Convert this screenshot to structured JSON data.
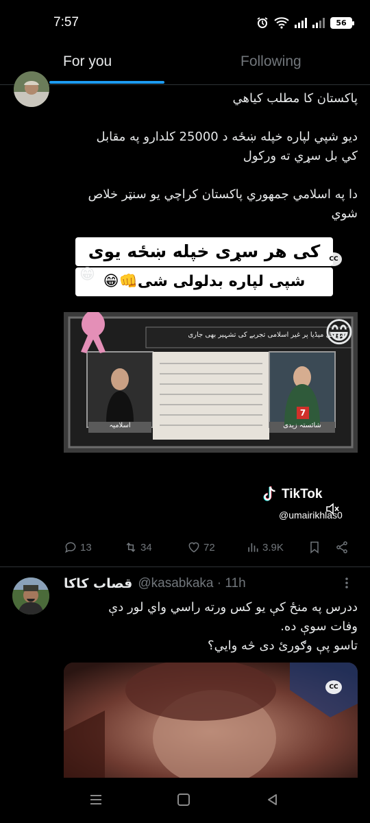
{
  "status_bar": {
    "time": "7:57",
    "battery": "56"
  },
  "tabs": [
    {
      "label": "For you",
      "active": true
    },
    {
      "label": "Following",
      "active": false
    }
  ],
  "colors": {
    "accent": "#1d9bf0",
    "muted": "#71767b",
    "text": "#e7e9ea",
    "background": "#000000"
  },
  "tweet1": {
    "lines": [
      "پاکستان کا مطلب  کیاھي",
      "دیو شپي لپاره  خپله ښځه د 25000 کلدارو په مقابل",
      "کي   بل سړي ته ورکول",
      "دا په اسلامي جمهوري پاکستان کراچي یو سنټر خلاص",
      "شوي"
    ],
    "media": {
      "caption_line1": "کی هر سړی خپله ښځه یوی",
      "caption_line2": "شپی لپاره بدلولی شی👊😁",
      "emoji_top": "😁",
      "emoji_side": "😁",
      "cc_label": "CC",
      "news_banner": "سوشل میڈیا پر غیر اسلامی تجربے کی تشہیر بھی جاری",
      "left_name_tag": "اسلامیہ",
      "right_name_tag": "شائستہ زیدی",
      "channel_tag": "7",
      "tiktok_logo": "TikTok",
      "tiktok_user": "@umairikhlas0"
    },
    "actions": {
      "replies": "13",
      "reposts": "34",
      "likes": "72",
      "views": "3.9K"
    }
  },
  "tweet2": {
    "name": "قصاب کاکا",
    "handle": "@kasabkaka · 11h",
    "lines": [
      "ددرس په منځ کې یو کس ورته راسي واي لور دې",
      "وفات سوې ده.",
      "تاسو پې وګورئ دی څه وایي؟"
    ],
    "media": {
      "cc_label": "CC"
    }
  }
}
